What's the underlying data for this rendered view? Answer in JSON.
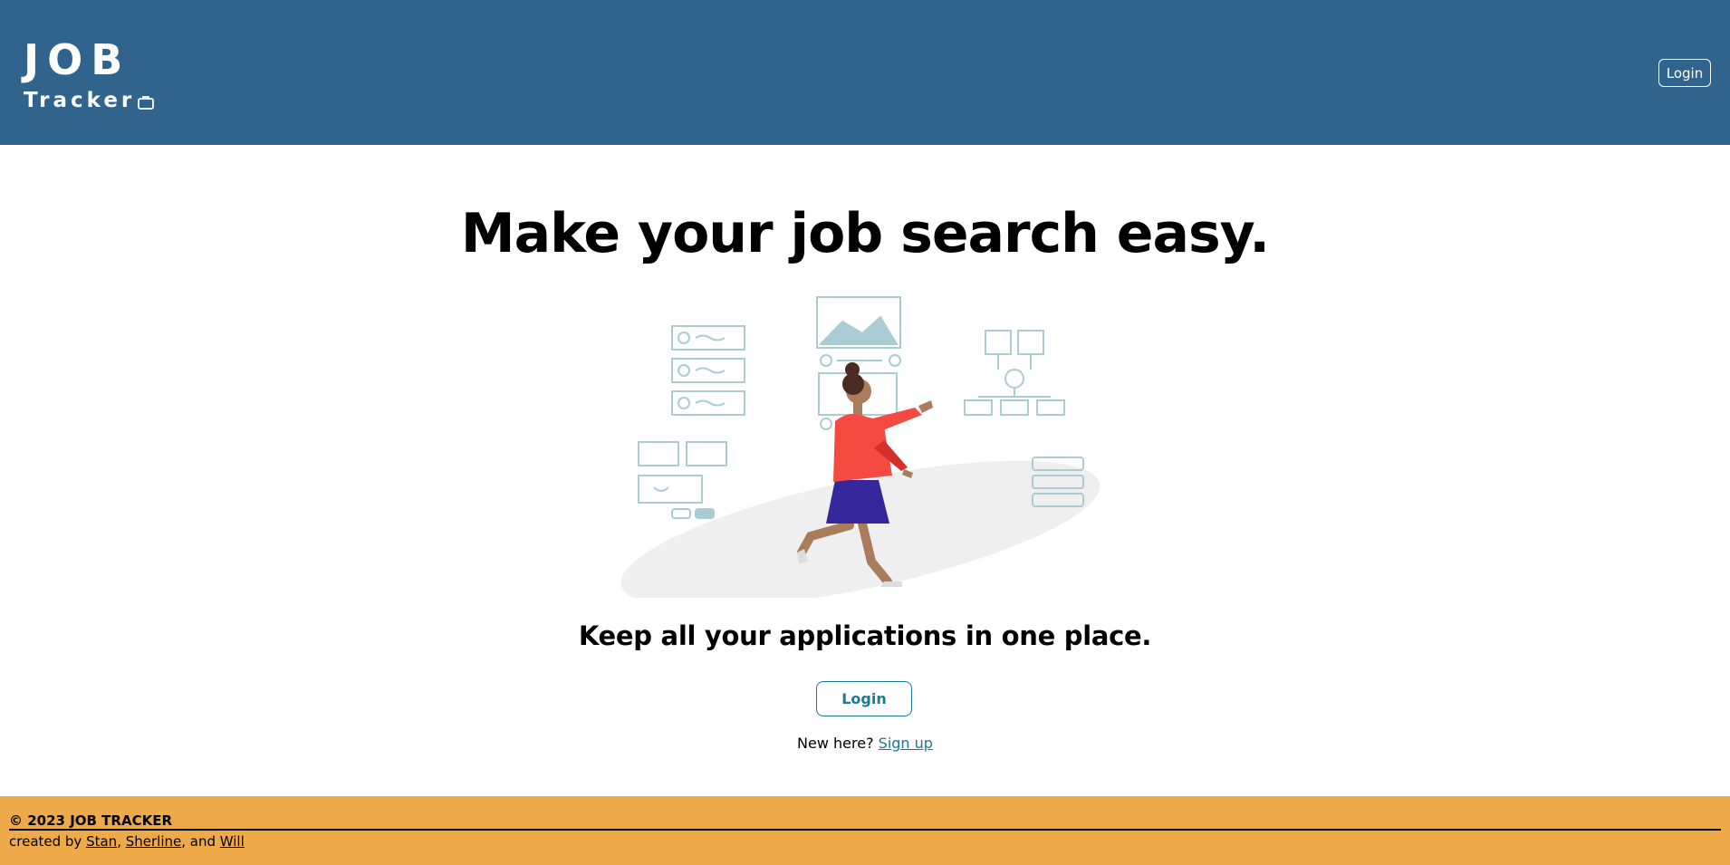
{
  "header": {
    "brand_line1": "JOB",
    "brand_line2": "Tracker",
    "login_label": "Login"
  },
  "hero": {
    "headline": "Make your job search easy.",
    "subhead": "Keep all your applications in one place.",
    "login_label": "Login",
    "new_here_text": "New here?",
    "signup_label": "Sign up"
  },
  "footer": {
    "copyright": "© 2023 JOB TRACKER",
    "created_by": "created by",
    "authors": [
      "Stan",
      "Sherline",
      "Will"
    ],
    "sep1": ", ",
    "sep2": ", and "
  },
  "colors": {
    "header_bg": "#30648c",
    "footer_bg": "#eeaa48",
    "accent": "#1b7a93"
  }
}
